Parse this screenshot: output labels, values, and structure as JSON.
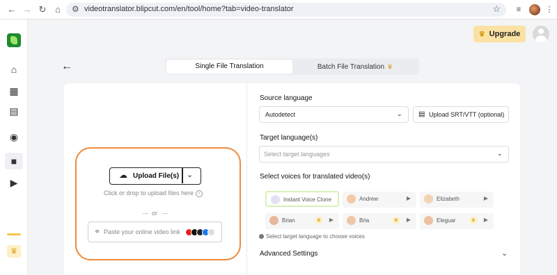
{
  "browser": {
    "url": "videotranslator.blipcut.com/en/tool/home?tab=video-translator",
    "back_icon": "←",
    "forward_icon": "→",
    "reload_icon": "↻",
    "home_icon": "⌂",
    "tune_icon": "⚙",
    "star_icon": "☆",
    "menu_icon": "⋮"
  },
  "header": {
    "upgrade_label": "Upgrade"
  },
  "tabs": [
    {
      "label": "Single File Translation",
      "active": true
    },
    {
      "label": "Batch File Translation",
      "active": false,
      "premium": true
    }
  ],
  "upload": {
    "button_label": "Upload File(s)",
    "drop_hint": "Click or drop to upload files here",
    "or_label": "or",
    "link_placeholder": "Paste your online video link",
    "platforms": [
      {
        "name": "youtube",
        "color": "#e62117"
      },
      {
        "name": "tiktok",
        "color": "#111111"
      },
      {
        "name": "x",
        "color": "#222222"
      },
      {
        "name": "facebook",
        "color": "#1877f2"
      },
      {
        "name": "more",
        "color": "#d9dde3"
      }
    ]
  },
  "source": {
    "label": "Source language",
    "value": "Autodetect",
    "srt_button": "Upload SRT/VTT (optional)"
  },
  "target": {
    "label": "Target language(s)",
    "placeholder": "Select target languages"
  },
  "voices": {
    "label": "Select voices for translated video(s)",
    "items": [
      {
        "name": "Instant Voice Clone",
        "selected": true,
        "premium": false,
        "avatar": "#e3e1f5"
      },
      {
        "name": "Andrew",
        "selected": false,
        "premium": false,
        "avatar": "#f4c9a8"
      },
      {
        "name": "Elizabeth",
        "selected": false,
        "premium": false,
        "avatar": "#f2d3b2"
      },
      {
        "name": "Brian",
        "selected": false,
        "premium": true,
        "avatar": "#e7b89b"
      },
      {
        "name": "Bria",
        "selected": false,
        "premium": true,
        "avatar": "#f1c6a6"
      },
      {
        "name": "Eleguar",
        "selected": false,
        "premium": true,
        "avatar": "#ecc1a2"
      }
    ],
    "note": "Select target language to choose voices"
  },
  "advanced": {
    "label": "Advanced Settings"
  },
  "colors": {
    "accent": "#f08a3a",
    "upgrade_bg": "#fbe2a4",
    "crown": "#d8a01c"
  }
}
